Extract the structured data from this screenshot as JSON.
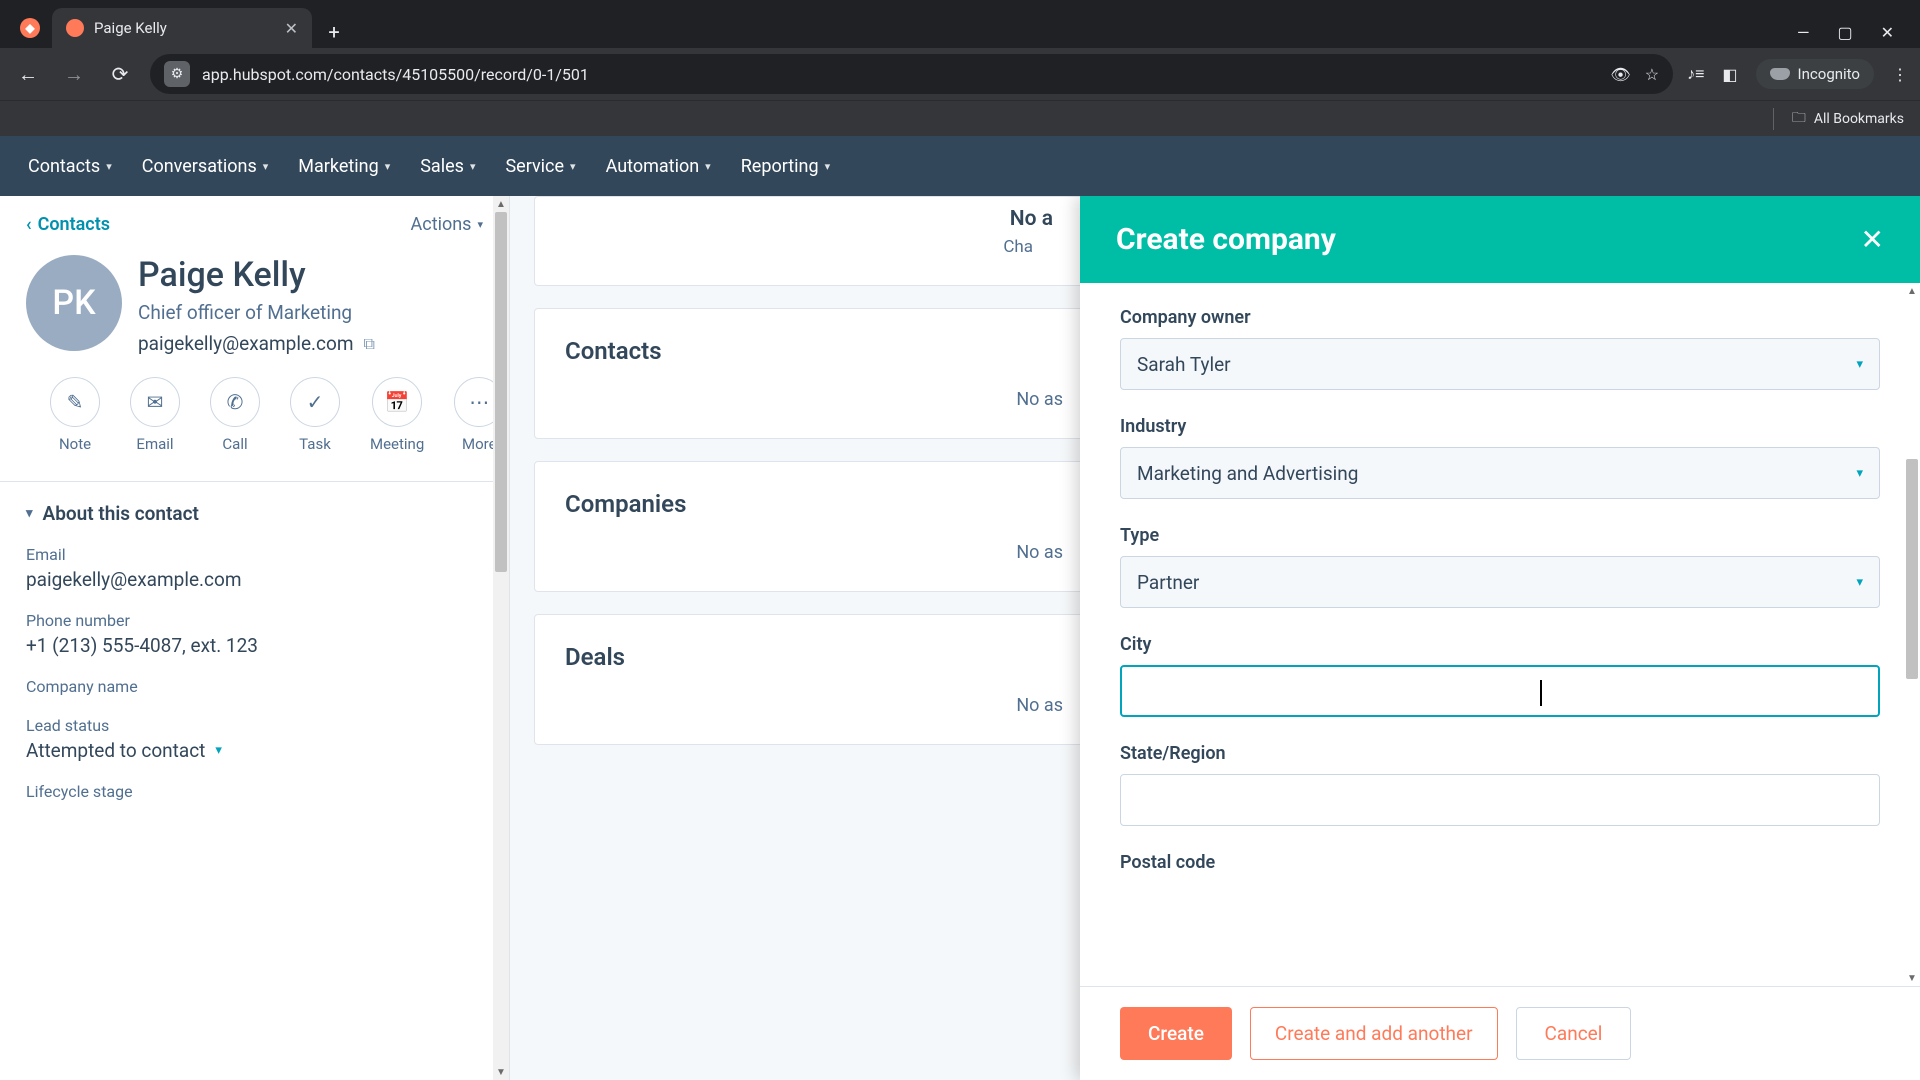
{
  "browser": {
    "tab_title": "Paige Kelly",
    "url": "app.hubspot.com/contacts/45105500/record/0-1/501",
    "incognito_label": "Incognito",
    "all_bookmarks": "All Bookmarks"
  },
  "nav": {
    "items": [
      "Contacts",
      "Conversations",
      "Marketing",
      "Sales",
      "Service",
      "Automation",
      "Reporting"
    ]
  },
  "sidebar": {
    "back_link": "Contacts",
    "actions": "Actions",
    "avatar_initials": "PK",
    "name": "Paige Kelly",
    "job_title": "Chief officer of Marketing",
    "email": "paigekelly@example.com",
    "action_buttons": [
      {
        "icon": "note-icon",
        "label": "Note"
      },
      {
        "icon": "email-icon",
        "label": "Email"
      },
      {
        "icon": "call-icon",
        "label": "Call"
      },
      {
        "icon": "task-icon",
        "label": "Task"
      },
      {
        "icon": "meeting-icon",
        "label": "Meeting"
      },
      {
        "icon": "more-icon",
        "label": "More"
      }
    ],
    "about_heading": "About this contact",
    "fields": {
      "email_label": "Email",
      "email_value": "paigekelly@example.com",
      "phone_label": "Phone number",
      "phone_value": "+1 (213) 555-4087, ext. 123",
      "company_label": "Company name",
      "company_value": "",
      "lead_status_label": "Lead status",
      "lead_status_value": "Attempted to contact",
      "lifecycle_label": "Lifecycle stage"
    }
  },
  "main": {
    "card0": {
      "title": "No a",
      "subtitle": "Cha"
    },
    "card1": {
      "title": "Contacts",
      "empty": "No as"
    },
    "card2": {
      "title": "Companies",
      "empty": "No as"
    },
    "card3": {
      "title": "Deals",
      "empty": "No as"
    }
  },
  "panel": {
    "title": "Create company",
    "company_owner_label": "Company owner",
    "company_owner_value": "Sarah Tyler",
    "industry_label": "Industry",
    "industry_value": "Marketing and Advertising",
    "type_label": "Type",
    "type_value": "Partner",
    "city_label": "City",
    "city_value": "",
    "state_label": "State/Region",
    "state_value": "",
    "postal_label": "Postal code",
    "create_btn": "Create",
    "create_another_btn": "Create and add another",
    "cancel_btn": "Cancel"
  },
  "colors": {
    "hubspot_orange": "#ff7a59",
    "hubspot_teal": "#00bda5",
    "hubspot_link": "#0091ae",
    "hubspot_navy": "#33475b"
  }
}
